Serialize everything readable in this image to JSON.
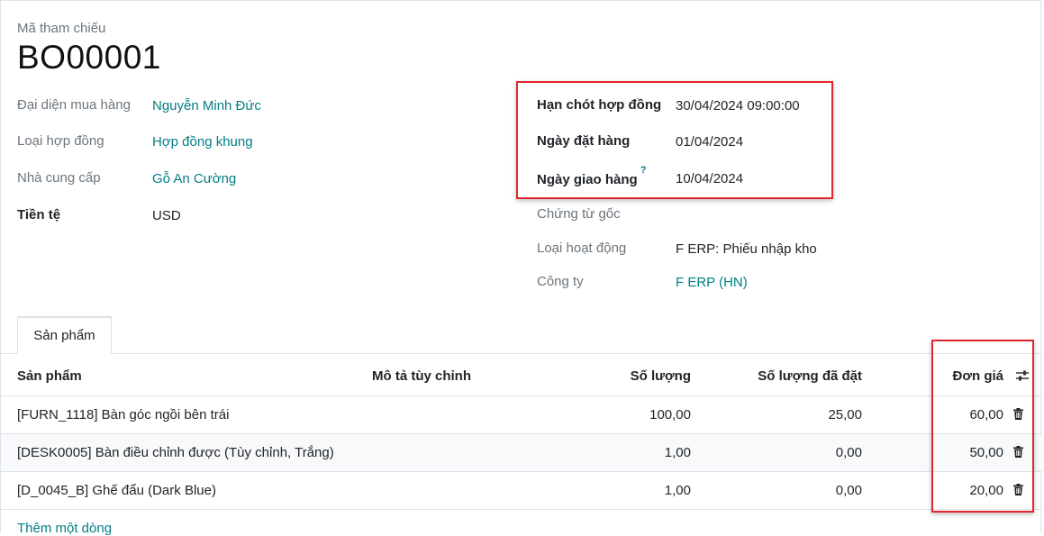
{
  "header": {
    "ref_label": "Mã tham chiếu",
    "ref_value": "BO00001"
  },
  "left_fields": [
    {
      "label": "Đại diện mua hàng",
      "value": "Nguyễn Minh Đức"
    },
    {
      "label": "Loại hợp đồng",
      "value": "Hợp đồng khung"
    },
    {
      "label": "Nhà cung cấp",
      "value": "Gỗ An Cường"
    },
    {
      "label": "Tiền tệ",
      "value": "USD"
    }
  ],
  "right_fields": [
    {
      "label": "Hạn chót hợp đồng",
      "value": "30/04/2024 09:00:00"
    },
    {
      "label": "Ngày đặt hàng",
      "value": "01/04/2024"
    },
    {
      "label": "Ngày giao hàng",
      "hint": "?",
      "value": "10/04/2024"
    },
    {
      "label": "Chứng từ gốc",
      "value": ""
    },
    {
      "label": "Loại hoạt động",
      "value": "F ERP: Phiếu nhập kho"
    },
    {
      "label": "Công ty",
      "value": "F ERP (HN)"
    }
  ],
  "tabs": [
    {
      "label": "Sản phẩm"
    }
  ],
  "table": {
    "columns": [
      "Sản phẩm",
      "Mô tả tùy chỉnh",
      "Số lượng",
      "Số lượng đã đặt",
      "Đơn giá"
    ],
    "rows": [
      {
        "product": "[FURN_1118] Bàn góc ngồi bên trái",
        "qty": "100,00",
        "ordered": "25,00",
        "price": "60,00"
      },
      {
        "product": "[DESK0005] Bàn điều chỉnh được (Tùy chỉnh, Trắng)",
        "qty": "1,00",
        "ordered": "0,00",
        "price": "50,00"
      },
      {
        "product": "[D_0045_B] Ghế đẩu (Dark Blue)",
        "qty": "1,00",
        "ordered": "0,00",
        "price": "20,00"
      }
    ],
    "add_line": "Thêm một dòng"
  },
  "colors": {
    "link": "#017e84",
    "highlight_box": "#e0272f"
  },
  "icons": {
    "delete": "trash-icon",
    "optional_columns": "column-settings-icon"
  }
}
